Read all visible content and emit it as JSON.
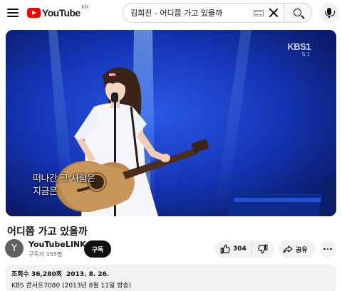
{
  "header": {
    "logo_text": "YouTube",
    "logo_region": "KR",
    "search_query": "김희진 - 어디쯤 가고 있을까"
  },
  "player": {
    "channel_mark": "KBS1",
    "channel_sub": "5.1",
    "caption_line1": "떠나간 그 사람은",
    "caption_line2": "지금은"
  },
  "video": {
    "title": "어디쯤 가고 있을까",
    "channel": {
      "avatar_letter": "Y",
      "name": "YouTubeLINK",
      "subscribers": "구독자 155명",
      "subscribe_label": "구독"
    },
    "actions": {
      "like_count": "304",
      "share_label": "공유"
    },
    "description": {
      "views": "조회수 36,280회",
      "date": "2013. 8. 26.",
      "text": "KBS 콘서트7080 (2013년 8월 11일 방송)"
    }
  },
  "colors": {
    "brand_red": "#ff0000",
    "stage_blue": "#0a1a6e"
  },
  "icons": [
    "menu-icon",
    "youtube-logo-icon",
    "keyboard-icon",
    "clear-icon",
    "search-icon",
    "mic-icon",
    "like-icon",
    "dislike-icon",
    "share-icon",
    "more-icon"
  ]
}
